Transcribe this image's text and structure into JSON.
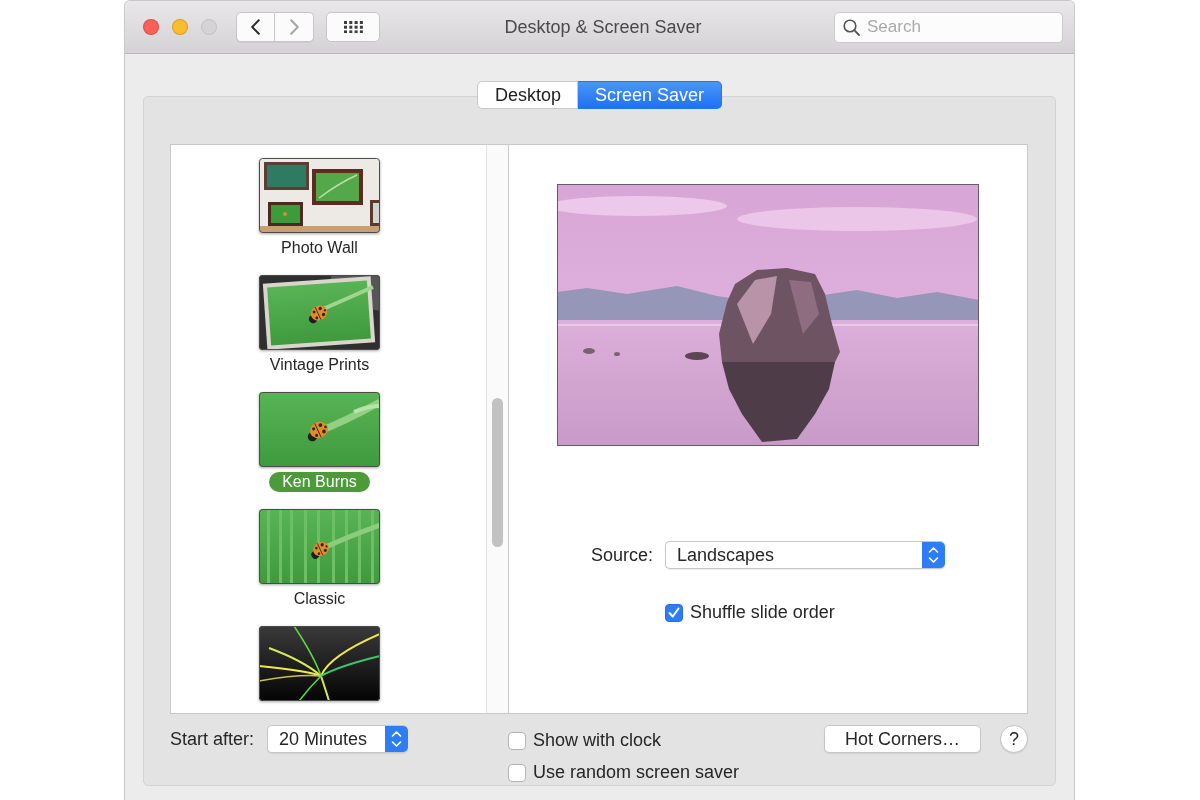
{
  "window": {
    "title": "Desktop & Screen Saver",
    "controls": [
      {
        "kind": "close",
        "disabled": false
      },
      {
        "kind": "minimize",
        "disabled": false
      },
      {
        "kind": "zoom",
        "disabled": true
      }
    ]
  },
  "toolbar": {
    "navigation": [
      {
        "kind": "back",
        "disabled": false
      },
      {
        "kind": "forward",
        "disabled": true
      }
    ],
    "search": {
      "placeholder": "Search"
    }
  },
  "tabs": [
    {
      "label": "Desktop",
      "selected": false
    },
    {
      "label": "Screen Saver",
      "selected": true
    }
  ],
  "screen_savers": [
    {
      "kind": "photo_wall",
      "label": "Photo Wall",
      "selected": false
    },
    {
      "kind": "vintage_prints",
      "label": "Vintage Prints",
      "selected": false
    },
    {
      "kind": "ken_burns",
      "label": "Ken Burns",
      "selected": true
    },
    {
      "kind": "classic",
      "label": "Classic",
      "selected": false
    },
    {
      "kind": "flurry",
      "selected": false
    }
  ],
  "options": {
    "source": {
      "label": "Source:",
      "value": "Landscapes"
    },
    "shuffle": {
      "label": "Shuffle slide order",
      "checked": true
    }
  },
  "footer": {
    "start_after": {
      "label": "Start after:",
      "value": "20 Minutes"
    },
    "checkboxes": [
      {
        "label": "Show with clock",
        "checked": false
      },
      {
        "label": "Use random screen saver",
        "checked": false
      }
    ],
    "hot_corners": "Hot Corners…",
    "help": "?"
  }
}
